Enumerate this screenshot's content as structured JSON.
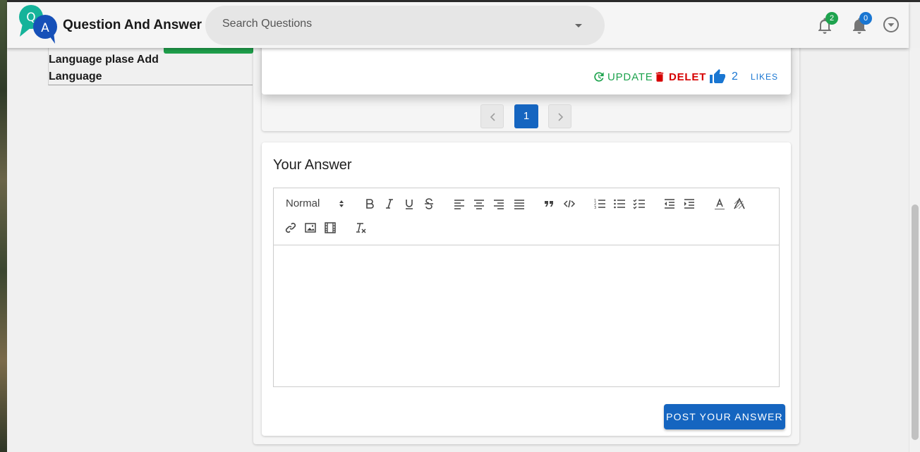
{
  "app": {
    "title": "Question And Answer",
    "logo_letters": [
      "Q",
      "A"
    ],
    "search_placeholder": "Search Questions",
    "notification_badge": "2",
    "alerts_badge": "0"
  },
  "sidebar": {
    "text": "Language plase Add Language"
  },
  "question": {
    "update_label": "UPDATE",
    "delete_label": "DELET",
    "like_count": "2",
    "likes_label": "LIKES"
  },
  "pagination": {
    "current_page": "1"
  },
  "answer": {
    "title": "Your Answer",
    "heading_select": "Normal",
    "post_label": "POST YOUR ANSWER"
  },
  "colors": {
    "primary": "#1565c0",
    "success": "#1ea34e",
    "danger": "#d60000",
    "link": "#1976d2"
  }
}
